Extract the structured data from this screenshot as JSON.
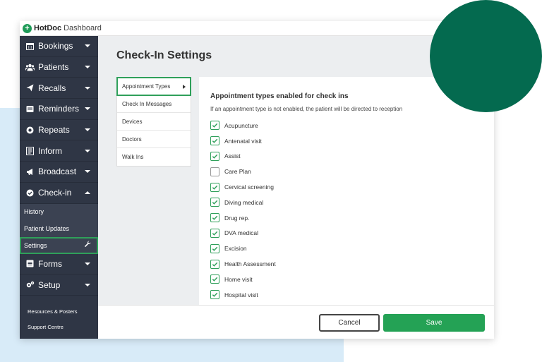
{
  "app": {
    "brand": "HotDoc",
    "brand_suffix": "Dashboard"
  },
  "sidebar": {
    "items": [
      {
        "label": "Bookings",
        "icon": "calendar-icon"
      },
      {
        "label": "Patients",
        "icon": "users-icon"
      },
      {
        "label": "Recalls",
        "icon": "paper-plane-icon"
      },
      {
        "label": "Reminders",
        "icon": "inbox-icon"
      },
      {
        "label": "Repeats",
        "icon": "repeat-icon"
      },
      {
        "label": "Inform",
        "icon": "document-icon"
      },
      {
        "label": "Broadcast",
        "icon": "megaphone-icon"
      },
      {
        "label": "Check-in",
        "icon": "check-circle-icon",
        "expanded": true
      }
    ],
    "checkin_sub": [
      "History",
      "Patient Updates",
      "Settings"
    ],
    "after": [
      {
        "label": "Forms",
        "icon": "forms-icon"
      },
      {
        "label": "Setup",
        "icon": "cogs-icon"
      }
    ],
    "footer": [
      "Resources & Posters",
      "Support Centre"
    ]
  },
  "page": {
    "title": "Check-In Settings"
  },
  "tabs": [
    "Appointment Types",
    "Check In Messages",
    "Devices",
    "Doctors",
    "Walk Ins"
  ],
  "content": {
    "heading": "Appointment types enabled for check ins",
    "subheading": "If an appointment type is not enabled, the patient will be directed to reception",
    "types": [
      {
        "label": "Acupuncture",
        "checked": true
      },
      {
        "label": "Antenatal visit",
        "checked": true
      },
      {
        "label": "Assist",
        "checked": true
      },
      {
        "label": "Care Plan",
        "checked": false
      },
      {
        "label": "Cervical screening",
        "checked": true
      },
      {
        "label": "Diving medical",
        "checked": true
      },
      {
        "label": "Drug rep.",
        "checked": true
      },
      {
        "label": "DVA medical",
        "checked": true
      },
      {
        "label": "Excision",
        "checked": true
      },
      {
        "label": "Health Assessment",
        "checked": true
      },
      {
        "label": "Home visit",
        "checked": true
      },
      {
        "label": "Hospital visit",
        "checked": true
      }
    ]
  },
  "actions": {
    "cancel": "Cancel",
    "save": "Save"
  },
  "colors": {
    "accent": "#24a255",
    "sidebar": "#2f3645",
    "deco": "#046a4f",
    "bg_block": "#d8ebf8"
  }
}
